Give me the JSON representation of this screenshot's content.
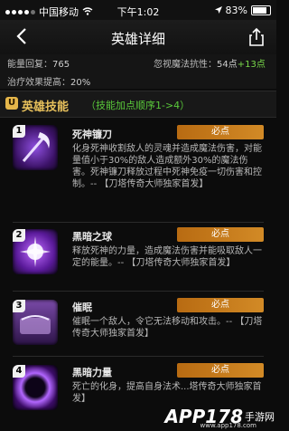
{
  "status_bar": {
    "carrier": "中国移动",
    "time": "下午1:02",
    "battery": "83%",
    "battery_level": 0.83
  },
  "nav": {
    "title": "英雄详细"
  },
  "stats": {
    "mana_regen_label": "能量回复：",
    "mana_regen_value": "765",
    "magic_resist_label": "忽视魔法抗性：",
    "magic_resist_value": "54点",
    "magic_resist_bonus": "+13点",
    "heal_label": "治疗效果提高：",
    "heal_value": "20%"
  },
  "section": {
    "title": "英雄技能",
    "subtitle": "（技能加点顺序1->4）"
  },
  "skills": [
    {
      "num": "1",
      "name": "死神镰刀",
      "badge": "必点",
      "icon": "scythe-icon",
      "desc": "化身死神收割敌人的灵魂并造成魔法伤害，对能量值小于30%的敌人造成额外30%的魔法伤害。死神镰刀释放过程中死神免疫一切伤害和控制。-- 【刀塔传奇大师独家首发】"
    },
    {
      "num": "2",
      "name": "黑暗之球",
      "badge": "必点",
      "icon": "dark-orb-icon",
      "desc": "释放死神的力量，造成魔法伤害并能吸取敌人一定的能量。-- 【刀塔传奇大师独家首发】"
    },
    {
      "num": "3",
      "name": "催眠",
      "badge": "必点",
      "icon": "hypnosis-icon",
      "desc": "催眠一个敌人，令它无法移动和攻击。-- 【刀塔传奇大师独家首发】"
    },
    {
      "num": "4",
      "name": "黑暗力量",
      "badge": "必点",
      "icon": "dark-power-icon",
      "desc": "死亡的化身，提高自身法术...塔传奇大师独家首发】"
    }
  ],
  "watermark": {
    "logo": "APP178",
    "text": "手游网",
    "sub": "www.app178.com"
  }
}
